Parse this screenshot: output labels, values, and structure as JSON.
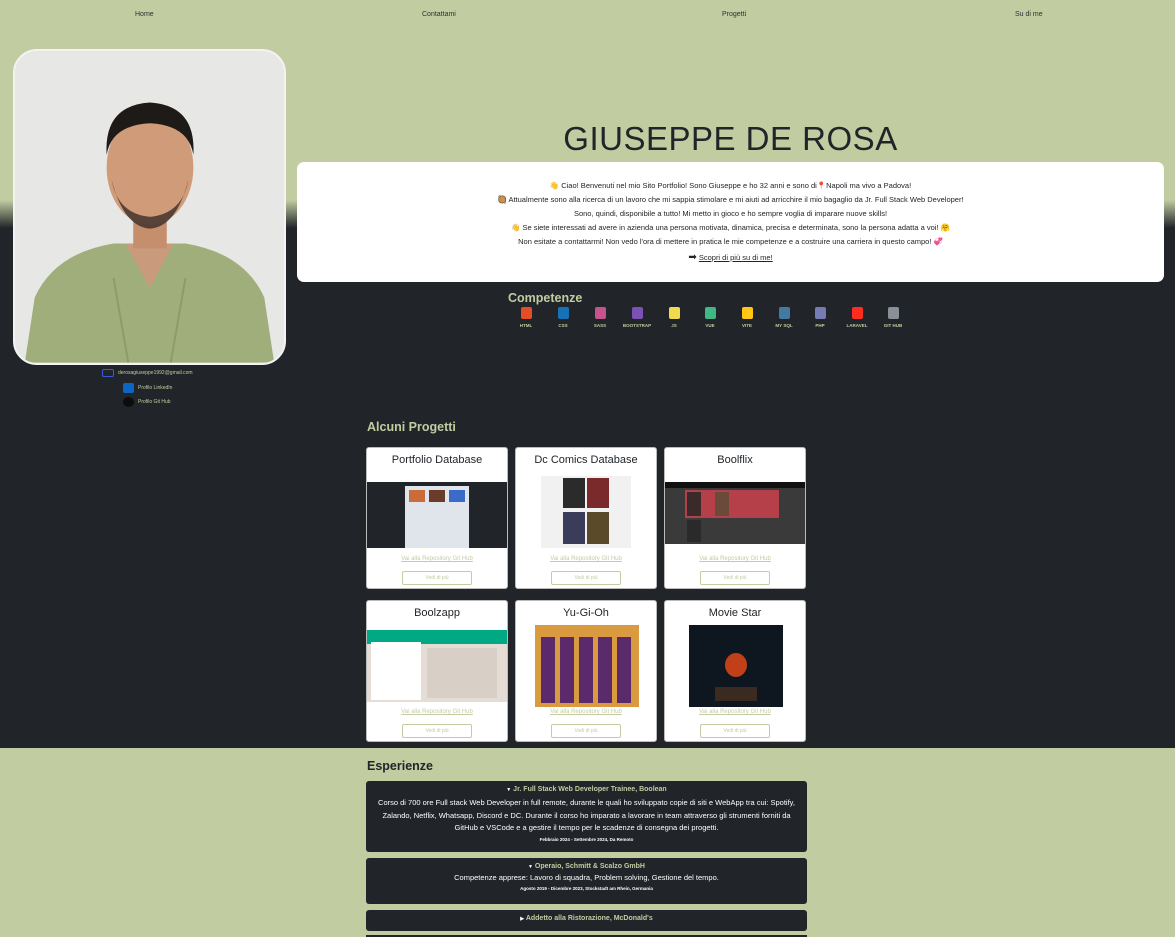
{
  "nav": [
    "Home",
    "Contattami",
    "Progetti",
    "Su di me"
  ],
  "contacts": {
    "email": "derosagiuseppe1992@gmail.com",
    "linkedin": "Profilo LinkedIn",
    "github": "Profilo Git Hub"
  },
  "hero": {
    "title": "GIUSEPPE DE ROSA",
    "lines": [
      "👋 Ciao! Benvenuti nel mio Sito Portfolio! Sono Giuseppe e ho 32 anni e sono di📍Napoli ma vivo a Padova!",
      "🥘 Attualmente sono alla ricerca di un lavoro che mi sappia stimolare e mi aiuti ad arricchire il mio bagaglio da Jr. Full Stack Web Developer!",
      "Sono, quindi, disponibile a tutto! Mi metto in gioco e ho sempre voglia di imparare nuove skills!",
      "👋 Se siete interessati ad avere in azienda una persona motivata, dinamica, precisa e determinata, sono la persona adatta a voi! 🤗",
      "Non esitate a contattarmi! Non vedo l'ora di mettere in pratica le mie competenze e a costruire una carriera in questo campo! 💞"
    ],
    "cta": "Scopri di più su di me!"
  },
  "skills_title": "Competenze",
  "skills": [
    {
      "label": "HTML",
      "color": "#e44d26"
    },
    {
      "label": "CSS",
      "color": "#1572b6"
    },
    {
      "label": "SASS",
      "color": "#c6538c"
    },
    {
      "label": "BOOTSTRAP",
      "color": "#7952b3"
    },
    {
      "label": "JS",
      "color": "#f0db4f"
    },
    {
      "label": "VUE",
      "color": "#41b883"
    },
    {
      "label": "VITE",
      "color": "#ffc517"
    },
    {
      "label": "MY SQL",
      "color": "#4479a1"
    },
    {
      "label": "PHP",
      "color": "#777bb3"
    },
    {
      "label": "LARAVEL",
      "color": "#ff2d20"
    },
    {
      "label": "GIT HUB",
      "color": "#8a8f98"
    }
  ],
  "projects_title": "Alcuni Progetti",
  "projects": [
    {
      "title": "Portfolio Database",
      "link": "Vai alla Repository Git Hub",
      "button": "Vedi di più"
    },
    {
      "title": "Dc Comics Database",
      "link": "Vai alla Repository Git Hub",
      "button": "Vedi di più"
    },
    {
      "title": "Boolflix",
      "link": "Vai alla Repository Git Hub",
      "button": "Vedi di più"
    },
    {
      "title": "Boolzapp",
      "link": "Vai alla Repository Git Hub",
      "button": "Vedi di più"
    },
    {
      "title": "Yu-Gi-Oh",
      "link": "Vai alla Repository Git Hub",
      "button": "Vedi di più"
    },
    {
      "title": "Movie Star",
      "link": "Vai alla Repository Git Hub",
      "button": "Vedi di più"
    }
  ],
  "experience_title": "Esperienze",
  "experiences": [
    {
      "title": "Jr. Full Stack Web Developer Trainee, Boolean",
      "desc": "Corso di 700 ore Full stack Web Developer in full remote, durante le quali ho sviluppato copie di siti e WebApp tra cui: Spotify, Zalando, Netflix, Whatsapp, Discord e DC. Durante il corso ho imparato a lavorare in team attraverso gli strumenti forniti da GitHub e VSCode e a gestire il tempo per le scadenze di consegna dei progetti.",
      "date": "Febbraio 2024 - Settembre 2024, Da Remoto"
    },
    {
      "title": "Operaio, Schmitt & Scalzo GmbH",
      "desc": "Competenze apprese: Lavoro di squadra, Problem solving, Gestione del tempo.",
      "date": "Agosto 2019 - Dicembre 2023, Stockstadt am Rhein, Germania"
    },
    {
      "title": "Addetto alla Ristorazione, McDonald's",
      "desc": "",
      "date": ""
    }
  ]
}
